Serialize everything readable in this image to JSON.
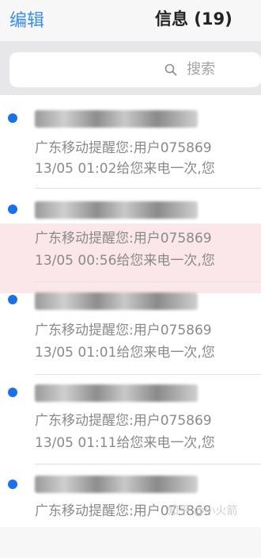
{
  "nav": {
    "edit_label": "编辑",
    "title": "信息 (19)"
  },
  "search": {
    "placeholder": "搜索"
  },
  "messages": [
    {
      "line1": "广东移动提醒您:用户075869",
      "line2": "13/05 01:02给您来电一次,您"
    },
    {
      "line1": "广东移动提醒您:用户075869",
      "line2": "13/05 00:56给您来电一次,您"
    },
    {
      "line1": "广东移动提醒您:用户075869",
      "line2": "13/05 01:01给您来电一次,您"
    },
    {
      "line1": "广东移动提醒您:用户075869",
      "line2": "13/05 01:11给您来电一次,您"
    },
    {
      "line1": "广东移动提醒您:用户075869",
      "line2": ""
    }
  ],
  "watermark": "知乎 @小火箭",
  "colors": {
    "accent": "#3a8ef0",
    "unread_dot": "#1b72e8"
  }
}
